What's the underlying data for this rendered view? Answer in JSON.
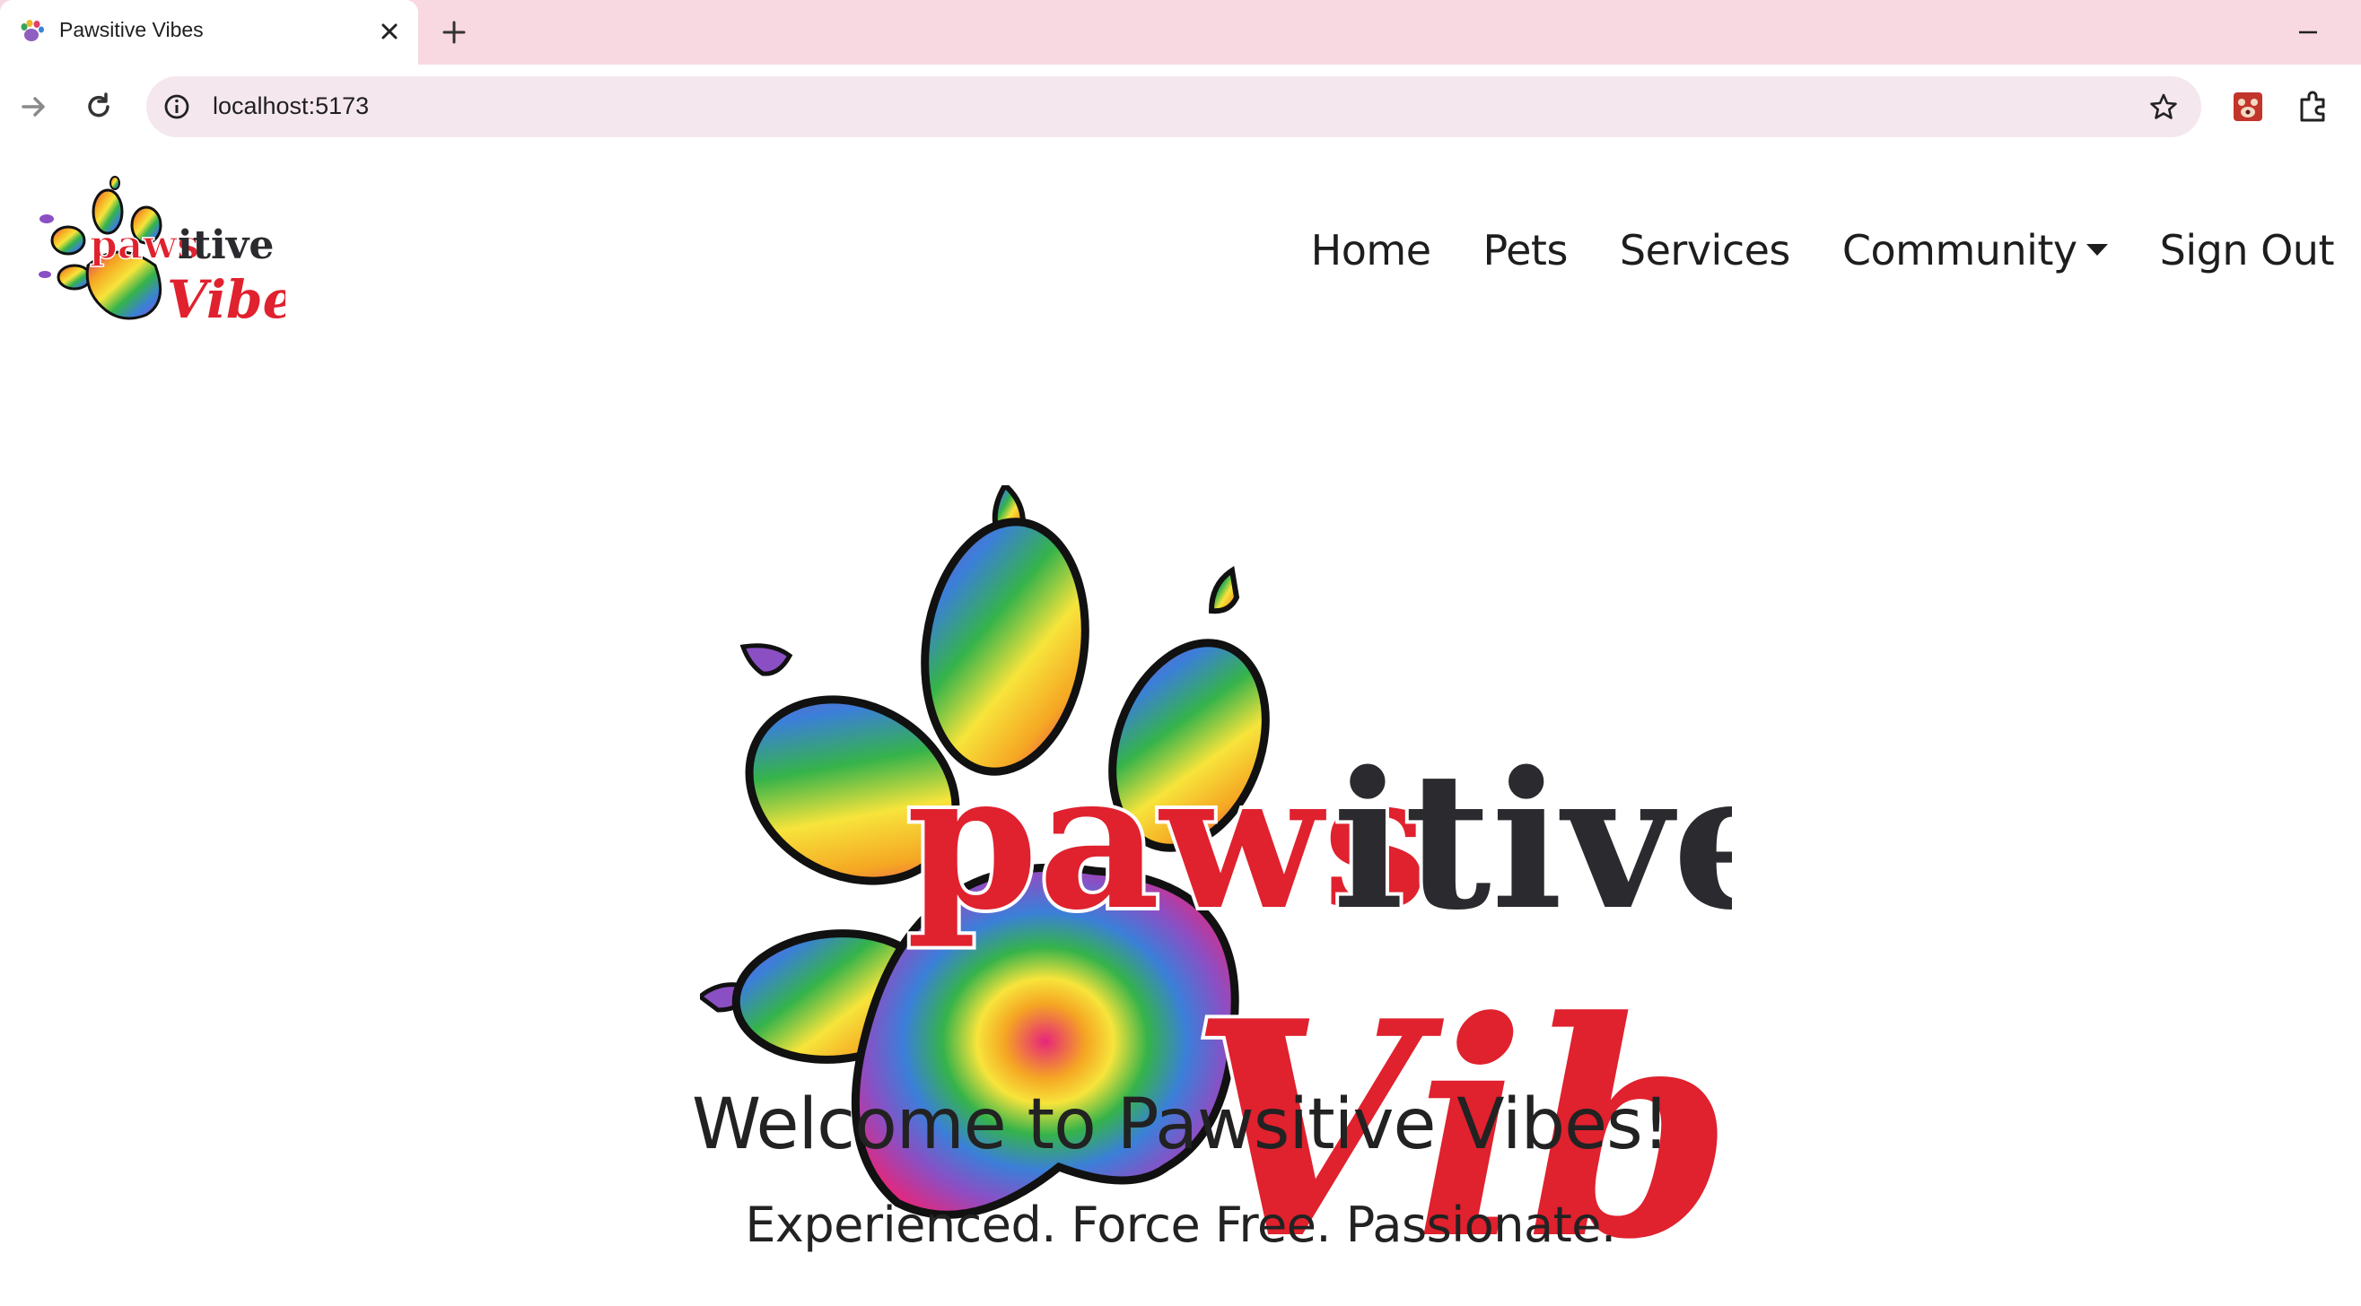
{
  "browser": {
    "tab_title": "Pawsitive Vibes",
    "url": "localhost:5173",
    "accent": "#f8d9e1"
  },
  "nav": {
    "items": [
      {
        "label": "Home",
        "dropdown": false
      },
      {
        "label": "Pets",
        "dropdown": false
      },
      {
        "label": "Services",
        "dropdown": false
      },
      {
        "label": "Community",
        "dropdown": true
      },
      {
        "label": "Sign Out",
        "dropdown": false
      }
    ]
  },
  "brand": {
    "logo_word_1": "paws",
    "logo_word_2": "itive",
    "logo_word_3": "Vibes",
    "red": "#e0212e",
    "dark": "#2b2a2e"
  },
  "hero": {
    "headline": "Welcome to Pawsitive Vibes!",
    "tagline": "Experienced. Force Free. Passionate."
  },
  "icons": [
    "paw-favicon-icon",
    "close-icon",
    "plus-icon",
    "minimize-icon",
    "forward-arrow-icon",
    "reload-icon",
    "site-info-icon",
    "star-icon",
    "extension-app-icon",
    "puzzle-icon",
    "chevron-down-icon"
  ]
}
